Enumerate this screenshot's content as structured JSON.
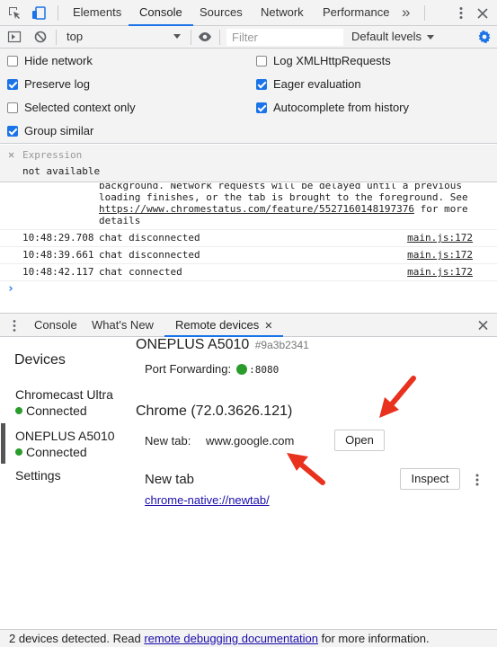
{
  "main_tabs": [
    {
      "label": "Elements"
    },
    {
      "label": "Console"
    },
    {
      "label": "Sources"
    },
    {
      "label": "Network"
    },
    {
      "label": "Performance"
    }
  ],
  "main_tabs_overflow": "»",
  "toolbar": {
    "context": "top",
    "filter_placeholder": "Filter",
    "levels": "Default levels"
  },
  "options": {
    "hide_network": {
      "label": "Hide network",
      "checked": false
    },
    "preserve_log": {
      "label": "Preserve log",
      "checked": true
    },
    "selected_context": {
      "label": "Selected context only",
      "checked": false
    },
    "group_similar": {
      "label": "Group similar",
      "checked": true
    },
    "log_xhr": {
      "label": "Log XMLHttpRequests",
      "checked": false
    },
    "eager_eval": {
      "label": "Eager evaluation",
      "checked": true
    },
    "autocomplete": {
      "label": "Autocomplete from history",
      "checked": true
    }
  },
  "expression": {
    "label": "Expression",
    "value": "not available"
  },
  "log": {
    "warning_text_1": "background. Network requests will be delayed until a previous",
    "warning_text_2": "loading finishes, or the tab is brought to the foreground. See",
    "warning_link": "https://www.chromestatus.com/feature/5527160148197376",
    "warning_text_3": " for more",
    "warning_text_4": "details",
    "entries": [
      {
        "time": "10:48:29.708",
        "message": "chat disconnected",
        "source": "main.js:172"
      },
      {
        "time": "10:48:39.661",
        "message": "chat disconnected",
        "source": "main.js:172"
      },
      {
        "time": "10:48:42.117",
        "message": "chat connected",
        "source": "main.js:172"
      }
    ],
    "prompt": "›"
  },
  "drawer_tabs": [
    {
      "label": "Console"
    },
    {
      "label": "What's New"
    },
    {
      "label": "Remote devices"
    }
  ],
  "remote": {
    "sidebar_title": "Devices",
    "devices": [
      {
        "name": "Chromecast Ultra",
        "status": "Connected"
      },
      {
        "name": "ONEPLUS A5010",
        "status": "Connected"
      }
    ],
    "settings_label": "Settings",
    "device_name": "ONEPLUS A5010",
    "device_serial": "#9a3b2341",
    "port_forwarding_label": "Port Forwarding:",
    "port": ":8080",
    "browser": "Chrome (72.0.3626.121)",
    "new_tab_label": "New tab:",
    "new_tab_url": "www.google.com",
    "open_button": "Open",
    "page_title": "New tab",
    "page_url": "chrome-native://newtab/",
    "inspect_button": "Inspect"
  },
  "status": {
    "prefix": "2 devices detected. Read ",
    "link": "remote debugging documentation",
    "suffix": " for more information."
  },
  "colors": {
    "accent": "#1a73e8",
    "connected": "#2b9b2b",
    "annotation_arrow": "#e8321e"
  }
}
